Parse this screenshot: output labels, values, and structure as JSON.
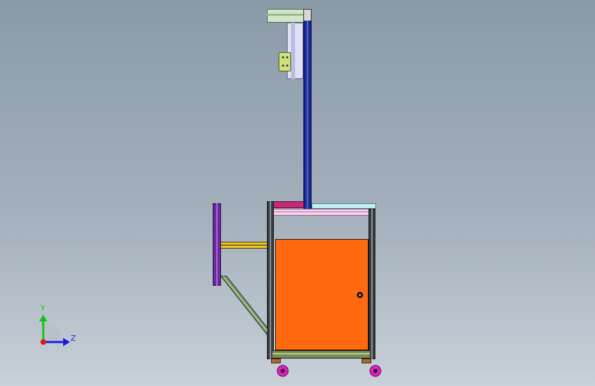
{
  "triad": {
    "y_label": "Y",
    "z_label": "Z",
    "colors": {
      "y": "#13c313",
      "z": "#1a1ae6",
      "x": "#e01414"
    }
  },
  "model": {
    "colors": {
      "door": "#ff6a10",
      "frame": "#3a3d40",
      "mast": "#1f2f9a",
      "top_panel": "#bff0f2",
      "magenta_bar": "#c4287a",
      "side_bar": "#6b2aa0",
      "yellow_bar": "#e8c830",
      "wheel": "#e020c0",
      "bracket": "#c9e0c0",
      "plate": "#c9e26a"
    }
  }
}
